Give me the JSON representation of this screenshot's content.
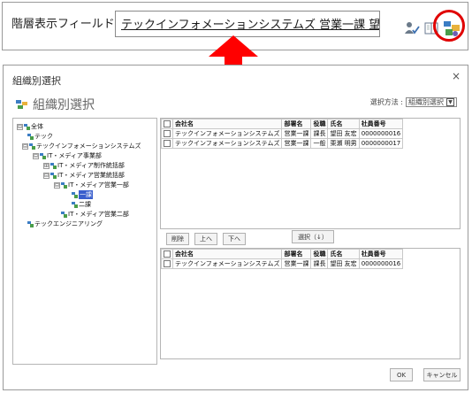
{
  "field": {
    "label": "階層表示フィールド",
    "value": "テックインフォメーションシステムズ 営業一課 望田 友宏"
  },
  "dialog": {
    "title": "組織別選択",
    "close": "×",
    "heading": "組織別選択",
    "select_method_label": "選択方法 :",
    "select_method_value": "組織別選択"
  },
  "tree": {
    "nodes": [
      {
        "label": "全体",
        "expander": "⊟"
      },
      {
        "label": "テック",
        "expander": ""
      },
      {
        "label": "テックインフォメーションシステムズ",
        "expander": "⊟"
      },
      {
        "label": "IT・メディア事業部",
        "expander": "⊟"
      },
      {
        "label": "IT・メディア制作統括部",
        "expander": "⊞"
      },
      {
        "label": "IT・メディア営業統括部",
        "expander": "⊟"
      },
      {
        "label": "IT・メディア営業一部",
        "expander": "⊟"
      },
      {
        "label": "一課",
        "expander": ""
      },
      {
        "label": "二課",
        "expander": ""
      },
      {
        "label": "IT・メディア営業二部",
        "expander": ""
      },
      {
        "label": "テックエンジニアリング",
        "expander": ""
      }
    ]
  },
  "top_grid": {
    "headers": [
      "会社名",
      "部署名",
      "役職",
      "氏名",
      "社員番号"
    ],
    "rows": [
      [
        "テックインフォメーションシステムズ",
        "営業一課",
        "課長",
        "望田 友宏",
        "0000000016"
      ],
      [
        "テックインフォメーションシステムズ",
        "営業一課",
        "一般",
        "栗瀬 明男",
        "0000000017"
      ]
    ]
  },
  "bottom_grid": {
    "headers": [
      "会社名",
      "部署名",
      "役職",
      "氏名",
      "社員番号"
    ],
    "rows": [
      [
        "テックインフォメーションシステムズ",
        "営業一課",
        "課長",
        "望田 友宏",
        "0000000016"
      ]
    ]
  },
  "buttons": {
    "delete": "削除",
    "up": "上へ",
    "down": "下へ",
    "select": "選択（↓）",
    "ok": "OK",
    "cancel": "キャンセル"
  },
  "colors": {
    "highlight_circle": "#e00000",
    "arrow": "#ff0000",
    "selected_node": "#3a5fcd"
  }
}
